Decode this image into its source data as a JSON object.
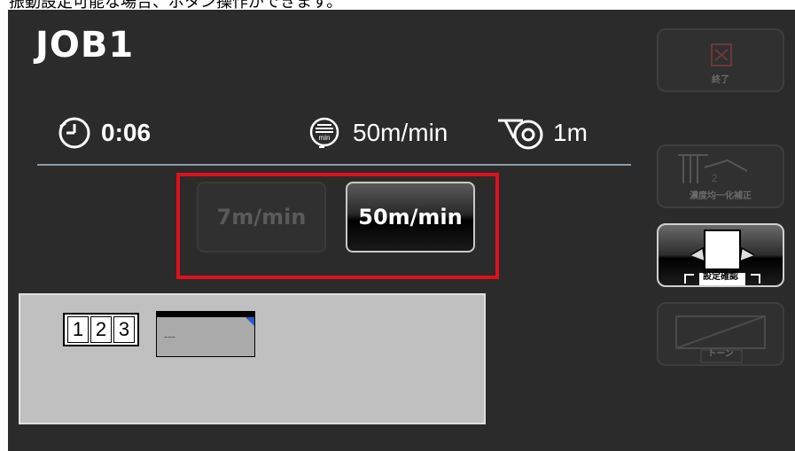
{
  "top_strip_text": "振動設定可能な場合、ボタン操作ができます。",
  "job": {
    "title": "JOB1"
  },
  "stats": {
    "time": "0:06",
    "speed": "50m/min",
    "length": "1m"
  },
  "speed_options": [
    {
      "label": "7m/min",
      "selected": false
    },
    {
      "label": "50m/min",
      "selected": true
    }
  ],
  "counter_digits": [
    "1",
    "2",
    "3"
  ],
  "thumbnail": {
    "placeholder": "---"
  },
  "side_buttons": [
    {
      "label": "終了",
      "enabled": false
    },
    {
      "label": "濃度均一化補正",
      "enabled": false
    },
    {
      "label": "設定確認",
      "enabled": true
    },
    {
      "label": "トーン",
      "enabled": false
    }
  ],
  "colors": {
    "highlight": "#e0101c",
    "panel": "#2b2b2b",
    "accent_blue": "#2a5ad0"
  }
}
